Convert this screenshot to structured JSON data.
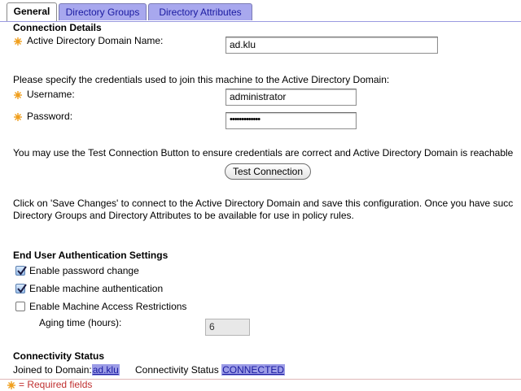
{
  "tabs": [
    {
      "label": "General",
      "active": true
    },
    {
      "label": "Directory Groups",
      "active": false
    },
    {
      "label": "Directory Attributes",
      "active": false
    }
  ],
  "connection": {
    "title": "Connection Details",
    "domain_label": "Active Directory Domain Name:",
    "domain_value": "ad.klu",
    "credentials_text": "Please specify the credentials used to join this machine to the Active Directory Domain:",
    "username_label": "Username:",
    "username_value": "administrator",
    "password_label": "Password:",
    "password_value": "•••••••••••••",
    "test_text": "You may use the Test Connection Button to ensure credentials are correct and Active Directory Domain is reachable",
    "test_button": "Test Connection",
    "save_text_1": "Click on 'Save Changes' to connect to the Active Directory Domain and save this configuration. Once you have succ",
    "save_text_2": "Directory Groups and Directory Attributes to be available for use in policy rules."
  },
  "auth": {
    "title": "End User Authentication Settings",
    "options": [
      {
        "label": "Enable password change",
        "checked": true
      },
      {
        "label": "Enable machine authentication",
        "checked": true
      },
      {
        "label": "Enable Machine Access Restrictions",
        "checked": false
      }
    ],
    "aging_label": "Aging time (hours):",
    "aging_value": "6"
  },
  "status": {
    "title": "Connectivity Status",
    "joined_label": "Joined to Domain:",
    "joined_value": "ad.klu",
    "conn_label": "Connectivity Status",
    "conn_value": "CONNECTED"
  },
  "footer": {
    "required_text": "= Required fields"
  },
  "colors": {
    "tab_inactive": "#a8a8ee",
    "link_highlight": "#9c9ce6",
    "required_icon": "#f0a020"
  }
}
